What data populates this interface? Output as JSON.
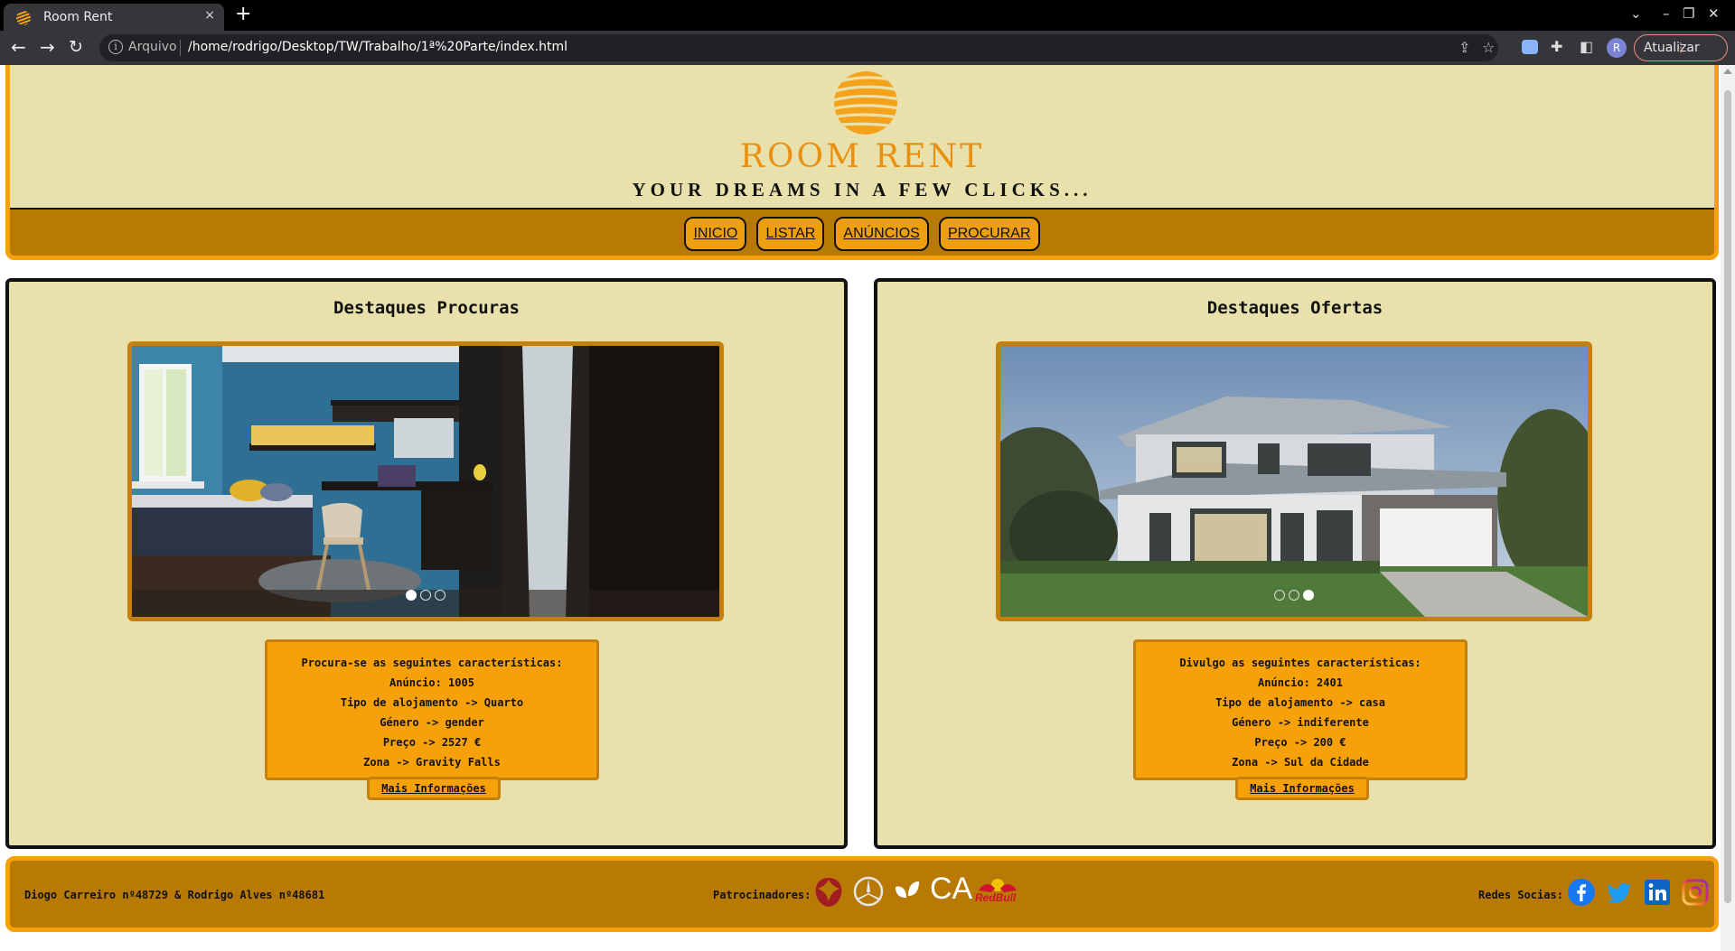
{
  "browser": {
    "tab_title": "Room Rent",
    "tab_close": "×",
    "new_tab": "+",
    "scheme_label": "Arquivo",
    "url": "/home/rodrigo/Desktop/TW/Trabalho/1ª%20Parte/index.html",
    "update_label": "Atualizar",
    "profile_initial": "R"
  },
  "header": {
    "brand": "ROOM RENT",
    "tagline": "YOUR DREAMS IN A FEW CLICKS..."
  },
  "nav": {
    "items": [
      "INICIO",
      "LISTAR",
      "ANÚNCIOS",
      "PROCURAR"
    ]
  },
  "procuras": {
    "title": "Destaques Procuras",
    "slide_index": 1,
    "slide_count": 3,
    "lines": [
      "Procura-se as seguintes características:",
      "Anúncio: 1005",
      "Tipo de alojamento -> Quarto",
      "Género -> gender",
      "Preço -> 2527 €",
      "Zona -> Gravity Falls"
    ],
    "button": "Mais Informações"
  },
  "ofertas": {
    "title": "Destaques Ofertas",
    "slide_index": 3,
    "slide_count": 3,
    "lines": [
      "Divulgo as seguintes características:",
      "Anúncio: 2401",
      "Tipo de alojamento -> casa",
      "Género -> indiferente",
      "Preço -> 200 €",
      "Zona -> Sul da Cidade"
    ],
    "button": "Mais Informações"
  },
  "footer": {
    "authors": "Diogo Carreiro nº48729 & Rodrigo Alves nº48681",
    "sponsors_label": "Patrocinadores:",
    "sponsor_ca": "CA",
    "sponsor_redbull": "RedBull",
    "social_label": "Redes Socias:"
  },
  "colors": {
    "page_bg": "#e9e1ab",
    "accent": "#f7a10a",
    "nav_bg": "#b87a05",
    "brand": "#e99010"
  },
  "icons": [
    "info-icon",
    "back-icon",
    "forward-icon",
    "reload-icon",
    "share-icon",
    "star-icon",
    "extension-icon",
    "sidepanel-icon",
    "facebook-icon",
    "twitter-icon",
    "linkedin-icon",
    "instagram-icon"
  ]
}
